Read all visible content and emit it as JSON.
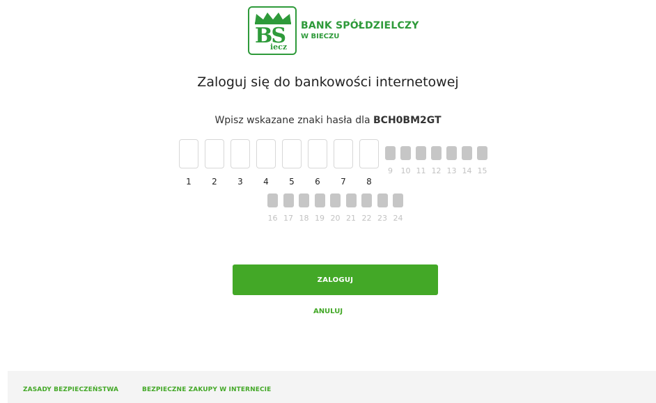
{
  "bank": {
    "logo_letters": "BS",
    "logo_sub": "iecz",
    "name_line1": "BANK SPÓŁDZIELCZY",
    "name_line2": "W BIECZU",
    "brand_color": "#2e9a3a"
  },
  "login": {
    "title": "Zaloguj się do bankowości internetowej",
    "instruction": "Wpisz wskazane znaki hasła dla",
    "user_id": "BCH0BM2GT",
    "password_positions": [
      "1",
      "2",
      "3",
      "4",
      "5",
      "6",
      "7",
      "8",
      "9",
      "10",
      "11",
      "12",
      "13",
      "14",
      "15",
      "16",
      "17",
      "18",
      "19",
      "20",
      "21",
      "22",
      "23",
      "24"
    ],
    "active_positions": [
      "1",
      "2",
      "3",
      "4",
      "5",
      "6",
      "7",
      "8"
    ],
    "login_button": "ZALOGUJ",
    "cancel_link": "ANULUJ",
    "accent_color": "#43a827"
  },
  "footer": {
    "links": [
      "ZASADY BEZPIECZEŃSTWA",
      "BEZPIECZNE ZAKUPY W INTERNECIE"
    ]
  }
}
